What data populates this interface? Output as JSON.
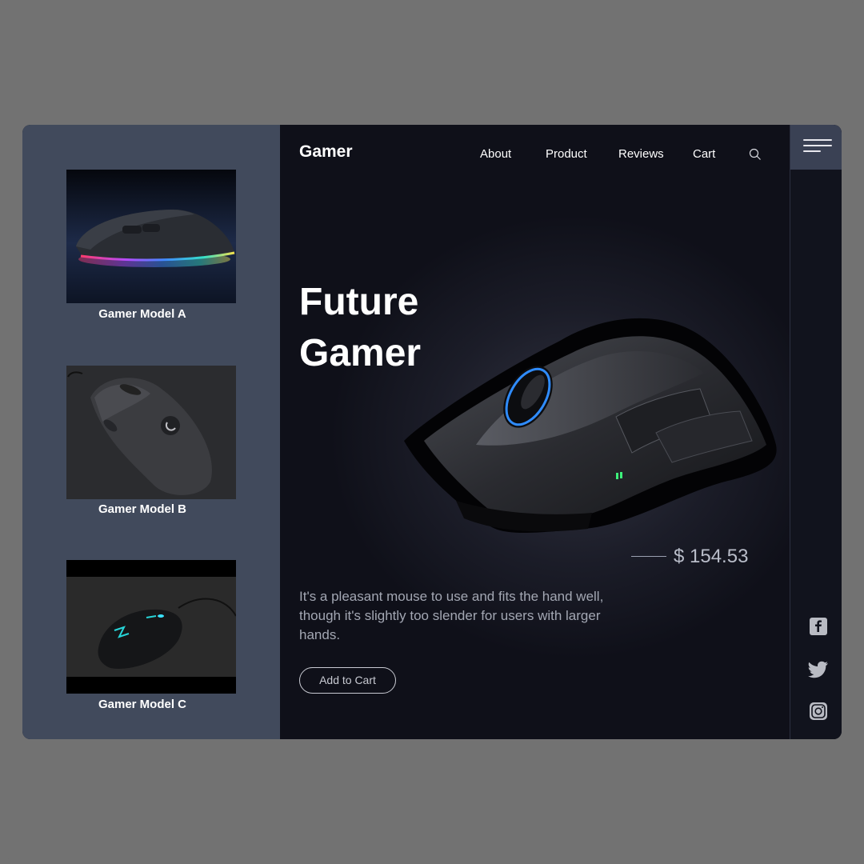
{
  "brand": "Gamer",
  "nav": {
    "items": [
      "About",
      "Product",
      "Reviews",
      "Cart"
    ]
  },
  "products": [
    {
      "name": "Gamer Model A"
    },
    {
      "name": "Gamer Model B"
    },
    {
      "name": "Gamer Model C"
    }
  ],
  "hero": {
    "title_line1": "Future",
    "title_line2": "Gamer",
    "price": "$ 154.53",
    "description": "It's a pleasant mouse to use and fits the hand well, though it's slightly too slender for users with larger hands.",
    "cta": "Add to Cart"
  },
  "icons": {
    "search": "search-icon",
    "menu": "hamburger-menu-icon",
    "social": [
      "facebook-icon",
      "twitter-icon",
      "instagram-icon"
    ]
  },
  "colors": {
    "page_bg": "#727272",
    "sidebar_bg": "#414a5c",
    "main_bg": "#0f1019",
    "menu_bg": "#3a4154",
    "text_primary": "#ffffff",
    "text_muted": "#a3a7b3"
  }
}
